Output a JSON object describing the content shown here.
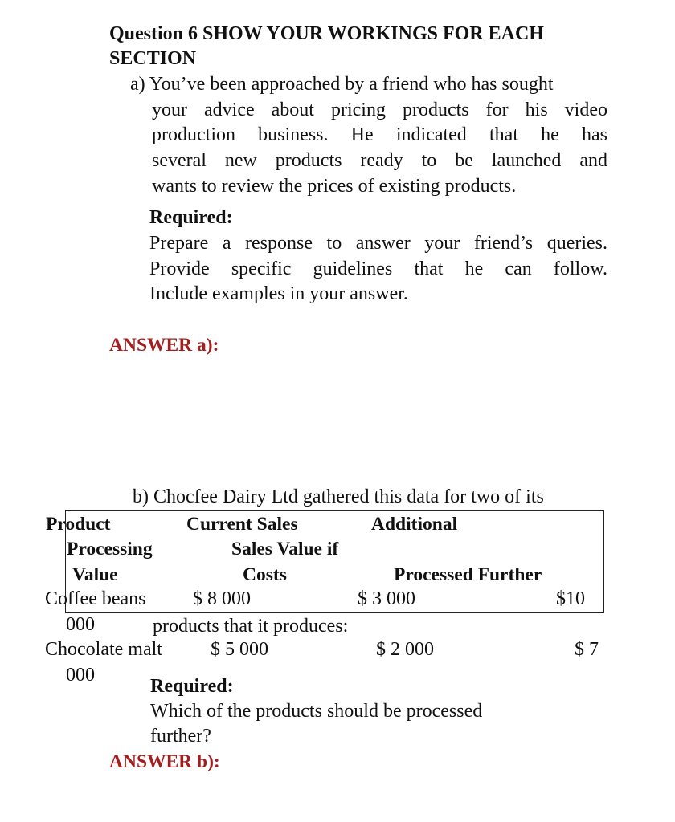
{
  "question": {
    "title_line1": "Question 6 SHOW YOUR WORKINGS FOR EACH",
    "title_line2": "SECTION"
  },
  "part_a": {
    "lines": [
      "a) You’ve been approached by a friend who has sought",
      "your advice about pricing products for his video",
      "production business. He indicated that he has",
      "several new products ready to be launched and",
      "wants to review the prices of existing products."
    ],
    "required_label": "Required:",
    "required_lines": [
      "Prepare a response to answer your friend’s queries.",
      "Provide specific guidelines that he can follow.",
      "Include examples in your answer."
    ],
    "answer_label": "ANSWER a):"
  },
  "part_b": {
    "intro_line1": "b) Chocfee Dairy Ltd gathered this data for two of its",
    "intro_line2": "products that it produces:",
    "table": {
      "headers": {
        "product": "Product",
        "current_sales": "Current Sales",
        "additional": "Additional",
        "processing": "Processing",
        "sales_value_if": "Sales Value if",
        "value": "Value",
        "costs": "Costs",
        "processed_further": "Processed Further"
      },
      "rows": [
        {
          "product": "Coffee beans",
          "current_sales_value": "$ 8 000",
          "additional_costs": "$ 3 000",
          "sales_value_if_processed_prefix": "$10",
          "sales_value_if_processed_suffix": "000"
        },
        {
          "product": "Chocolate malt",
          "current_sales_value": "$ 5 000",
          "additional_costs": "$ 2 000",
          "sales_value_if_processed_prefix": "$ 7",
          "sales_value_if_processed_suffix": "000"
        }
      ]
    },
    "required_label": "Required:",
    "required_line1": "Which of the products should be processed",
    "required_line2": "further?",
    "answer_label": "ANSWER b):"
  },
  "colors": {
    "answer_label": "#a31f1f",
    "text": "#111111"
  }
}
